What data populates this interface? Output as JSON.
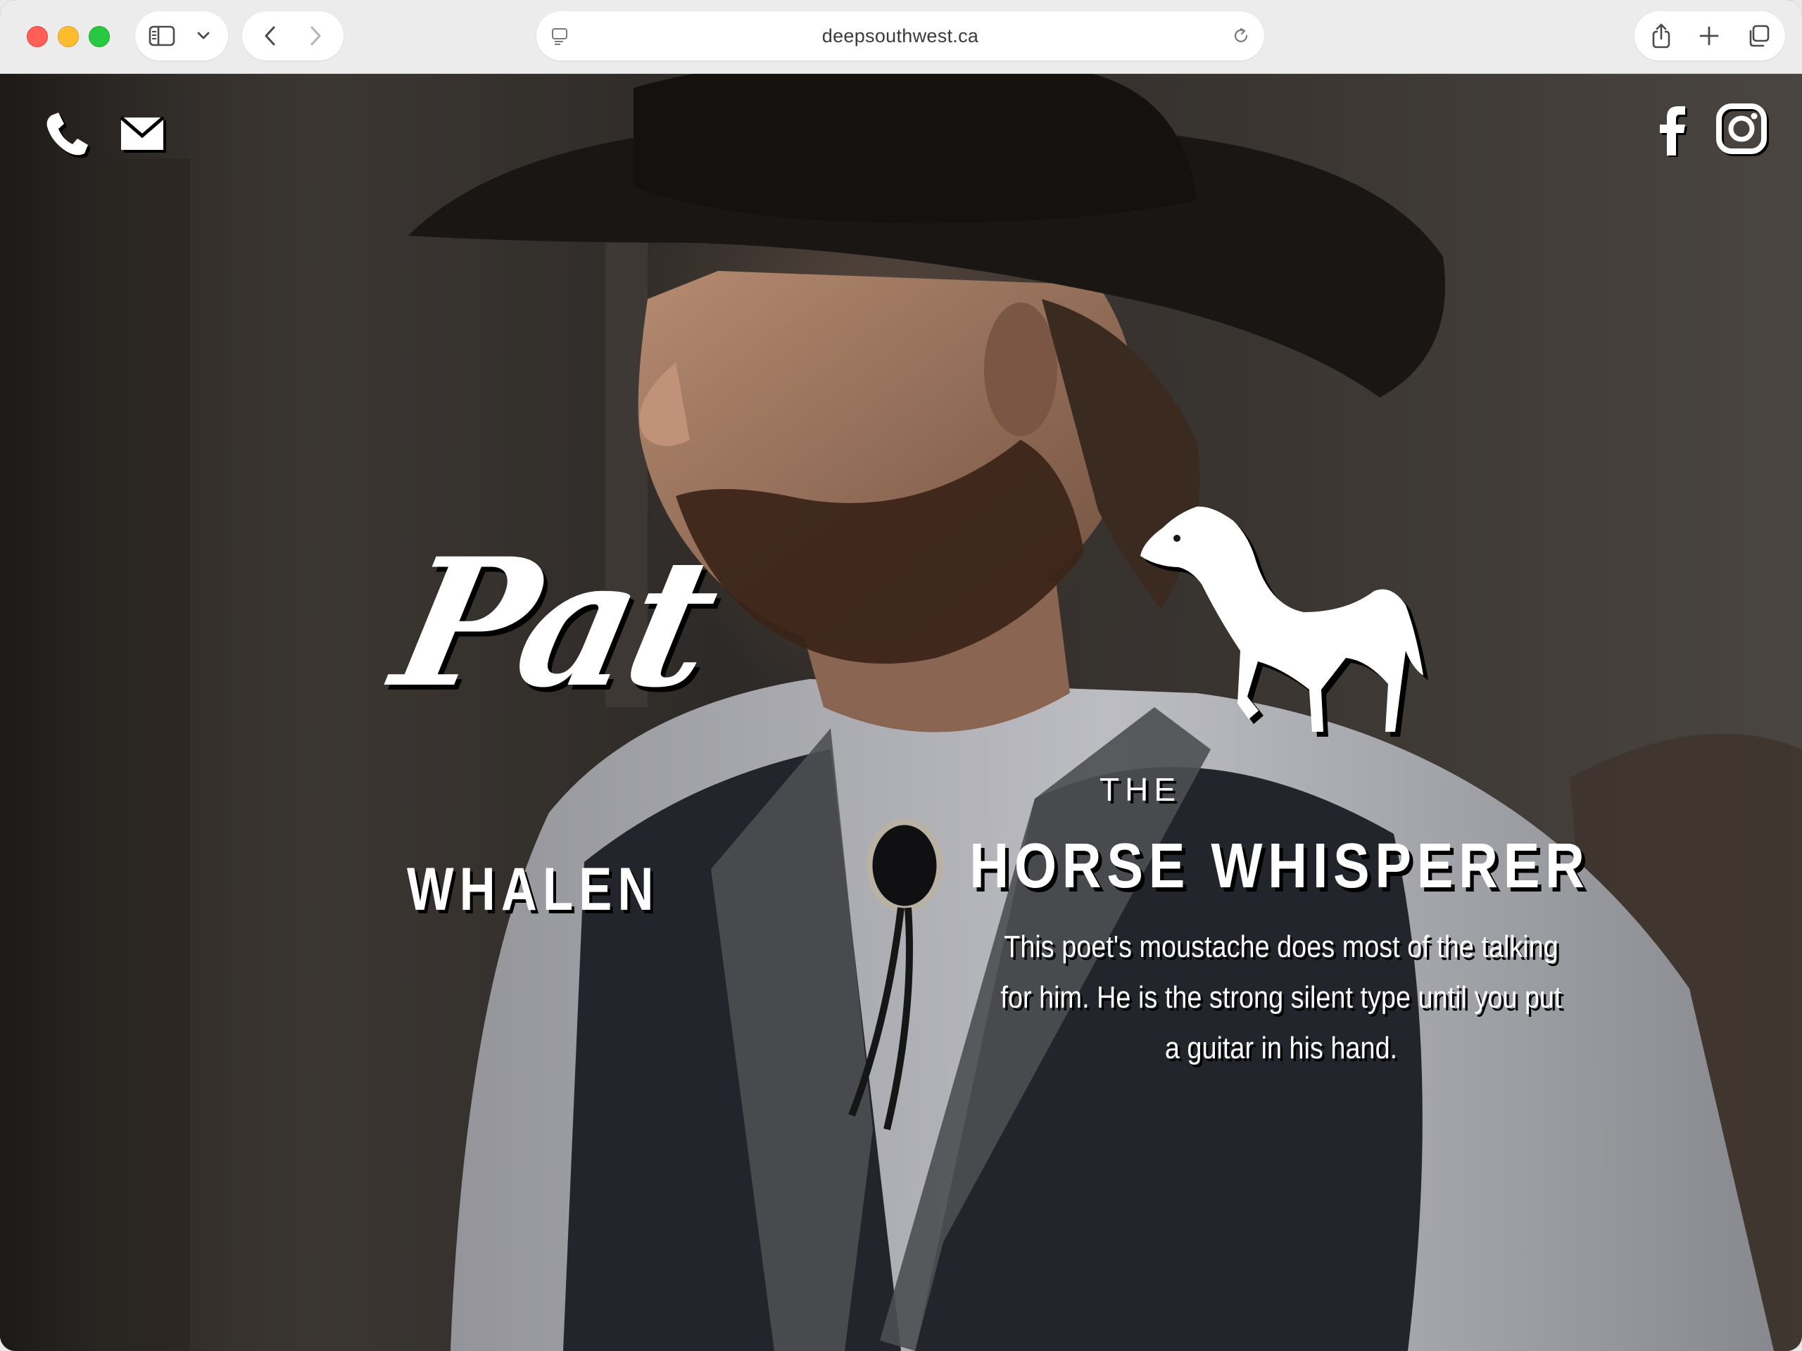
{
  "browser": {
    "url": "deepsouthwest.ca",
    "icons": {
      "sidebar": "sidebar-icon",
      "chevron": "chevron-down-icon",
      "back": "back-arrow-icon",
      "forward": "forward-arrow-icon",
      "site_settings": "page-settings-icon",
      "reload": "reload-icon",
      "share": "share-icon",
      "new_tab": "plus-icon",
      "tabs_overview": "tabs-overview-icon"
    }
  },
  "header": {
    "contact_icons": [
      "phone-icon",
      "mail-icon"
    ],
    "social_icons": [
      "facebook-icon",
      "instagram-icon"
    ]
  },
  "hero": {
    "first_name": "Pat",
    "last_name": "WHALEN",
    "title_prefix": "THE",
    "title": "HORSE WHISPERER",
    "tagline": "This poet's moustache does most of the talking for him. He is the strong silent type until you put a guitar in his hand.",
    "emblem": "horse-icon"
  },
  "colors": {
    "text": "#ffffff",
    "shadow": "#000000",
    "chrome_bg": "#ececec"
  }
}
